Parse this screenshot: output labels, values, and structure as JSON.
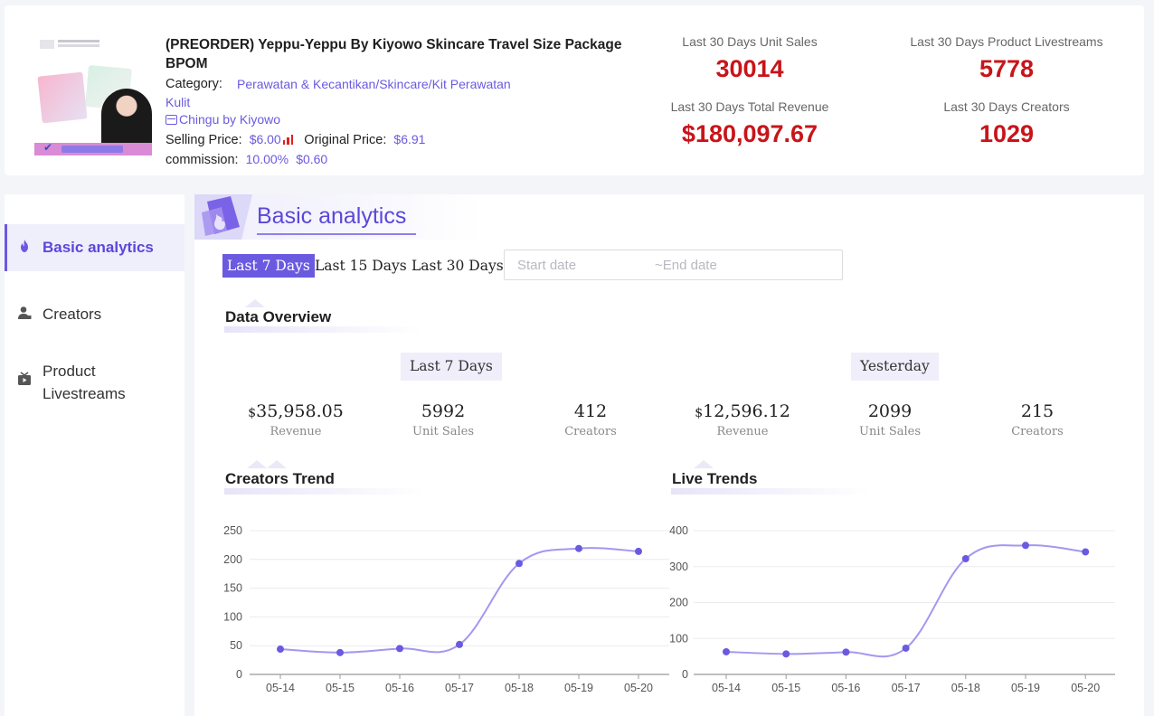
{
  "product": {
    "title": "(PREORDER) Yeppu-Yeppu By Kiyowo Skincare Travel Size Package BPOM",
    "category_label": "Category:",
    "category_value": "Perawatan & Kecantikan/Skincare/Kit Perawatan Kulit",
    "store_name": "Chingu by Kiyowo",
    "selling_price_label": "Selling Price:",
    "selling_price": "$6.00",
    "original_price_label": "Original Price:",
    "original_price": "$6.91",
    "commission_label": "commission:",
    "commission_rate": "10.00%",
    "commission_amount": "$0.60",
    "icon": "trend-bars-icon"
  },
  "stats": {
    "unit_sales_label": "Last 30 Days Unit Sales",
    "unit_sales": "30014",
    "livestreams_label": "Last 30 Days Product Livestreams",
    "livestreams": "5778",
    "revenue_label": "Last 30 Days Total Revenue",
    "revenue": "$180,097.67",
    "creators_label": "Last 30 Days Creators",
    "creators": "1029"
  },
  "sidebar": {
    "items": [
      {
        "label": "Basic analytics",
        "icon": "flame-icon",
        "active": true
      },
      {
        "label": "Creators",
        "icon": "person-icon",
        "active": false
      },
      {
        "label": "Product Livestreams",
        "icon": "tv-icon",
        "active": false
      }
    ]
  },
  "main": {
    "title": "Basic analytics",
    "ranges": [
      "Last 7 Days",
      "Last 15 Days",
      "Last 30 Days"
    ],
    "active_range": "Last 7 Days",
    "date_start_placeholder": "Start date",
    "date_end_placeholder": "~End date",
    "overview_title": "Data Overview",
    "periods": [
      {
        "label": "Last 7 Days",
        "currency": "$",
        "revenue": "35,958.05",
        "revenue_label": "Revenue",
        "unit_sales": "5992",
        "unit_sales_label": "Unit Sales",
        "creators": "412",
        "creators_label": "Creators"
      },
      {
        "label": "Yesterday",
        "currency": "$",
        "revenue": "12,596.12",
        "revenue_label": "Revenue",
        "unit_sales": "2099",
        "unit_sales_label": "Unit Sales",
        "creators": "215",
        "creators_label": "Creators"
      }
    ],
    "creators_trend_title": "Creators Trend",
    "live_trends_title": "Live Trends"
  },
  "colors": {
    "accent": "#6a5ae0",
    "stat_red": "#c8141a",
    "line": "#a497ef",
    "point": "#6a5ae0"
  },
  "chart_data": [
    {
      "type": "line",
      "title": "Creators Trend",
      "categories": [
        "05-14",
        "05-15",
        "05-16",
        "05-17",
        "05-18",
        "05-19",
        "05-20"
      ],
      "values": [
        44,
        38,
        45,
        52,
        193,
        219,
        214
      ],
      "ylim": [
        0,
        250
      ],
      "yticks": [
        0,
        50,
        100,
        150,
        200,
        250
      ],
      "grid": true,
      "smooth": true
    },
    {
      "type": "line",
      "title": "Live Trends",
      "categories": [
        "05-14",
        "05-15",
        "05-16",
        "05-17",
        "05-18",
        "05-19",
        "05-20"
      ],
      "values": [
        63,
        57,
        62,
        73,
        322,
        359,
        341
      ],
      "ylim": [
        0,
        400
      ],
      "yticks": [
        0,
        100,
        200,
        300,
        400
      ],
      "grid": true,
      "smooth": true
    }
  ]
}
